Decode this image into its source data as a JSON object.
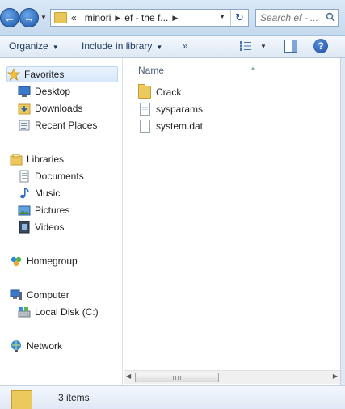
{
  "address": {
    "crumbs": [
      "minori",
      "ef - the f..."
    ],
    "overflow_marker": "«",
    "search_placeholder": "Search ef - ..."
  },
  "toolbar": {
    "organize_label": "Organize",
    "include_label": "Include in library",
    "more_label": "»"
  },
  "nav": {
    "favorites": "Favorites",
    "desktop": "Desktop",
    "downloads": "Downloads",
    "recent": "Recent Places",
    "libraries": "Libraries",
    "documents": "Documents",
    "music": "Music",
    "pictures": "Pictures",
    "videos": "Videos",
    "homegroup": "Homegroup",
    "computer": "Computer",
    "local_disk": "Local Disk (C:)",
    "network": "Network"
  },
  "content": {
    "column_name": "Name",
    "files": [
      {
        "name": "Crack",
        "type": "folder"
      },
      {
        "name": "sysparams",
        "type": "file"
      },
      {
        "name": "system.dat",
        "type": "file"
      }
    ]
  },
  "details": {
    "item_count": "3 items"
  }
}
